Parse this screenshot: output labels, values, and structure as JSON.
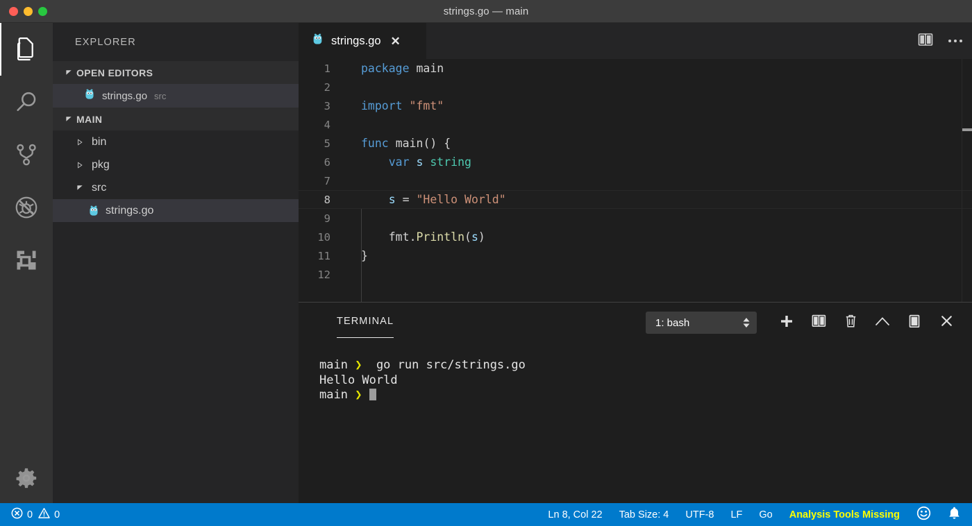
{
  "window": {
    "title": "strings.go — main",
    "traffic_lights": [
      "close",
      "minimize",
      "zoom"
    ]
  },
  "activity_bar": {
    "items": [
      {
        "name": "explorer",
        "icon": "files-icon",
        "active": true
      },
      {
        "name": "search",
        "icon": "search-icon",
        "active": false
      },
      {
        "name": "source-control",
        "icon": "source-control-icon",
        "active": false
      },
      {
        "name": "run-and-debug",
        "icon": "debug-icon",
        "active": false
      },
      {
        "name": "extensions",
        "icon": "extensions-icon",
        "active": false
      }
    ],
    "manage": {
      "name": "manage",
      "icon": "gear-icon"
    }
  },
  "sidebar": {
    "title": "EXPLORER",
    "open_editors": {
      "header": "OPEN EDITORS",
      "expanded": true,
      "items": [
        {
          "name": "strings.go",
          "description": "src",
          "icon": "go-gopher-icon",
          "selected": true
        }
      ]
    },
    "folder": {
      "header": "MAIN",
      "expanded": true,
      "tree": [
        {
          "label": "bin",
          "type": "folder",
          "expanded": false,
          "selected": false
        },
        {
          "label": "pkg",
          "type": "folder",
          "expanded": false,
          "selected": false
        },
        {
          "label": "src",
          "type": "folder",
          "expanded": true,
          "selected": false
        },
        {
          "label": "strings.go",
          "type": "file",
          "icon": "go-gopher-icon",
          "selected": true
        }
      ]
    }
  },
  "editor": {
    "tabs": [
      {
        "label": "strings.go",
        "icon": "go-gopher-icon",
        "active": true,
        "close_glyph": "✕"
      }
    ],
    "actions": [
      {
        "name": "split-editor",
        "icon": "split-editor-icon"
      },
      {
        "name": "more-actions",
        "icon": "ellipsis-icon"
      }
    ],
    "language": "Go",
    "current_line": 8,
    "lines": [
      {
        "num": "1",
        "tokens": [
          {
            "t": "package",
            "c": "kw"
          },
          {
            "t": " ",
            "c": "pl"
          },
          {
            "t": "main",
            "c": "pl"
          }
        ]
      },
      {
        "num": "2",
        "tokens": []
      },
      {
        "num": "3",
        "tokens": [
          {
            "t": "import",
            "c": "kw"
          },
          {
            "t": " ",
            "c": "pl"
          },
          {
            "t": "\"fmt\"",
            "c": "str"
          }
        ]
      },
      {
        "num": "4",
        "tokens": []
      },
      {
        "num": "5",
        "tokens": [
          {
            "t": "func",
            "c": "kw"
          },
          {
            "t": " ",
            "c": "pl"
          },
          {
            "t": "main",
            "c": "pl"
          },
          {
            "t": "() {",
            "c": "pl"
          }
        ]
      },
      {
        "num": "6",
        "tokens": [
          {
            "t": "    ",
            "c": "pl"
          },
          {
            "t": "var",
            "c": "kw"
          },
          {
            "t": " ",
            "c": "pl"
          },
          {
            "t": "s",
            "c": "var"
          },
          {
            "t": " ",
            "c": "pl"
          },
          {
            "t": "string",
            "c": "typ"
          }
        ]
      },
      {
        "num": "7",
        "tokens": []
      },
      {
        "num": "8",
        "tokens": [
          {
            "t": "    ",
            "c": "pl"
          },
          {
            "t": "s",
            "c": "var"
          },
          {
            "t": " = ",
            "c": "pl"
          },
          {
            "t": "\"Hello World\"",
            "c": "str"
          }
        ]
      },
      {
        "num": "9",
        "tokens": []
      },
      {
        "num": "10",
        "tokens": [
          {
            "t": "    ",
            "c": "pl"
          },
          {
            "t": "fmt",
            "c": "pl"
          },
          {
            "t": ".",
            "c": "pl"
          },
          {
            "t": "Println",
            "c": "fn"
          },
          {
            "t": "(",
            "c": "pl"
          },
          {
            "t": "s",
            "c": "var"
          },
          {
            "t": ")",
            "c": "pl"
          }
        ]
      },
      {
        "num": "11",
        "tokens": [
          {
            "t": "}",
            "c": "pl"
          }
        ]
      },
      {
        "num": "12",
        "tokens": []
      }
    ]
  },
  "panel": {
    "tabs": [
      {
        "label": "TERMINAL",
        "active": true
      }
    ],
    "terminal_select": {
      "value": "1: bash",
      "options": [
        "1: bash"
      ]
    },
    "actions": [
      {
        "name": "new-terminal",
        "icon": "plus-icon"
      },
      {
        "name": "split-terminal",
        "icon": "split-icon"
      },
      {
        "name": "kill-terminal",
        "icon": "trash-icon"
      },
      {
        "name": "maximize-panel",
        "icon": "chevron-up-icon"
      },
      {
        "name": "toggle-panel-position",
        "icon": "panel-icon"
      },
      {
        "name": "close-panel",
        "icon": "close-icon"
      }
    ],
    "terminal_lines": [
      {
        "prompt": "main",
        "arrow": "❯",
        "text": " go run src/strings.go"
      },
      {
        "prompt": "",
        "arrow": "",
        "text": "Hello World"
      },
      {
        "prompt": "main",
        "arrow": "❯",
        "text": "",
        "cursor": true
      }
    ]
  },
  "status_bar": {
    "left": [
      {
        "name": "errors",
        "icon": "error-icon",
        "value": "0"
      },
      {
        "name": "warnings",
        "icon": "warning-icon",
        "value": "0"
      }
    ],
    "right": [
      {
        "name": "cursor-position",
        "label": "Ln 8, Col 22"
      },
      {
        "name": "tab-size",
        "label": "Tab Size: 4"
      },
      {
        "name": "encoding",
        "label": "UTF-8"
      },
      {
        "name": "eol",
        "label": "LF"
      },
      {
        "name": "language-mode",
        "label": "Go"
      },
      {
        "name": "analysis-tools",
        "label": "Analysis Tools Missing",
        "highlight": true
      }
    ],
    "icons": [
      {
        "name": "feedback-smiley-icon"
      },
      {
        "name": "notifications-bell-icon"
      }
    ]
  },
  "colors": {
    "accent": "#007acc",
    "titlebar": "#3c3c3c",
    "activitybar": "#333333",
    "sidebar": "#252526",
    "editor": "#1e1e1e",
    "selected_row": "#37373d",
    "go_blue": "#5dc9e2",
    "warning_yellow": "#ffff00",
    "terminal_arrow": "#e5e500"
  }
}
